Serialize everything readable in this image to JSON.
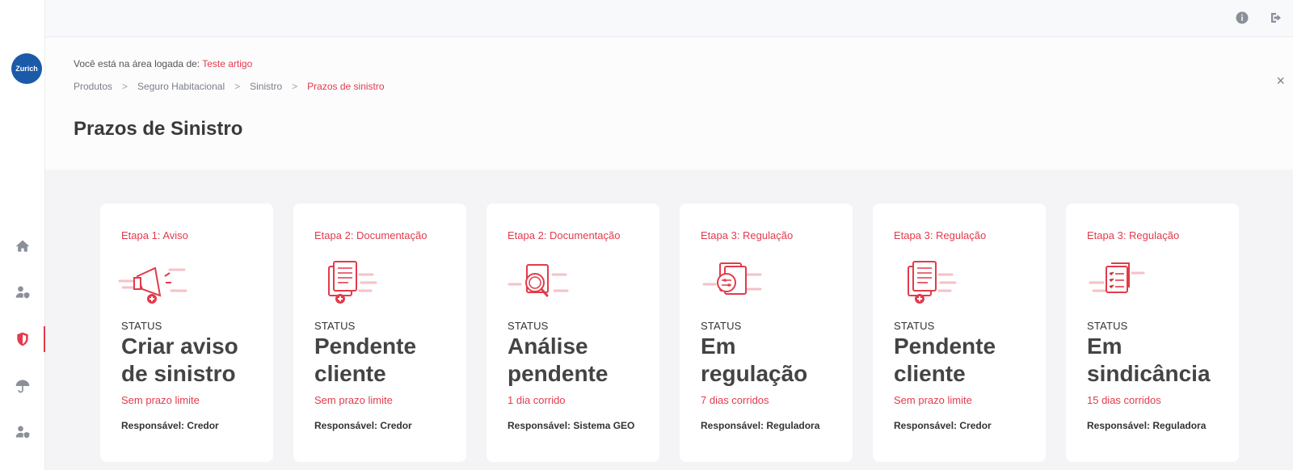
{
  "brand": {
    "logo_text": "Zurich",
    "accent": "#e23b4b",
    "logo_color": "#1a5aa8"
  },
  "sidebar": {
    "items": [
      {
        "name": "home",
        "icon": "home-icon"
      },
      {
        "name": "users",
        "icon": "user-shield-icon"
      },
      {
        "name": "shield",
        "icon": "shield-icon",
        "active": true
      },
      {
        "name": "umbrella",
        "icon": "umbrella-icon"
      },
      {
        "name": "user-shield-2",
        "icon": "user-shield-icon"
      }
    ]
  },
  "topbar": {
    "info_icon": "info-icon",
    "logout_icon": "logout-icon"
  },
  "header": {
    "logged_prefix": "Você está na área logada de:",
    "logged_user": "Teste artigo",
    "breadcrumb": [
      "Produtos",
      "Seguro Habitacional",
      "Sinistro",
      "Prazos de sinistro"
    ],
    "separator": ">",
    "close_glyph": "×",
    "title": "Prazos de Sinistro"
  },
  "cards": [
    {
      "stage": "Etapa 1: Aviso",
      "icon": "megaphone-icon",
      "status_label": "STATUS",
      "status": "Criar aviso de sinistro",
      "deadline": "Sem prazo limite",
      "responsible": "Responsável: Credor"
    },
    {
      "stage": "Etapa 2: Documentação",
      "icon": "document-add-icon",
      "status_label": "STATUS",
      "status": "Pendente cliente",
      "deadline": "Sem prazo limite",
      "responsible": "Responsável: Credor"
    },
    {
      "stage": "Etapa 2: Documentação",
      "icon": "document-search-icon",
      "status_label": "STATUS",
      "status": "Análise pendente",
      "deadline": "1 dia corrido",
      "responsible": "Responsável: Sistema GEO"
    },
    {
      "stage": "Etapa 3: Regulação",
      "icon": "document-settings-icon",
      "status_label": "STATUS",
      "status": "Em regulação",
      "deadline": "7 dias corridos",
      "responsible": "Responsável: Reguladora"
    },
    {
      "stage": "Etapa 3: Regulação",
      "icon": "document-add-icon",
      "status_label": "STATUS",
      "status": "Pendente cliente",
      "deadline": "Sem prazo limite",
      "responsible": "Responsável: Credor"
    },
    {
      "stage": "Etapa 3: Regulação",
      "icon": "checklist-icon",
      "status_label": "STATUS",
      "status": "Em sindicância",
      "deadline": "15 dias corridos",
      "responsible": "Responsável: Reguladora"
    }
  ]
}
